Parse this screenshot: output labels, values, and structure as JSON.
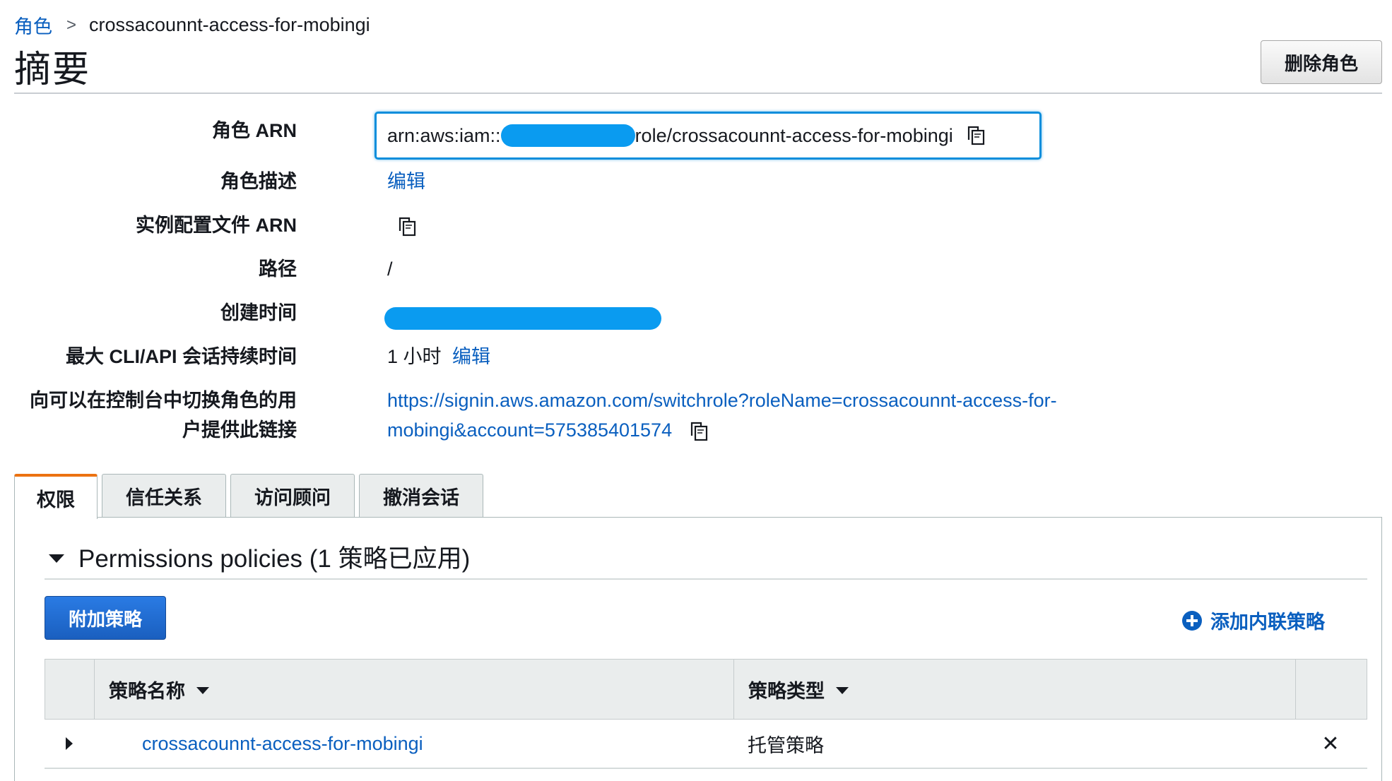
{
  "breadcrumb": {
    "parent": "角色",
    "separator": ">",
    "current": "crossacounnt-access-for-mobingi"
  },
  "page_title": "摘要",
  "delete_button": "删除角色",
  "summary": {
    "role_arn_label": "角色 ARN",
    "role_arn_prefix": "arn:aws:iam::",
    "role_arn_suffix": "role/crossacounnt-access-for-mobingi",
    "role_desc_label": "角色描述",
    "role_desc_edit": "编辑",
    "instance_profile_label": "实例配置文件 ARN",
    "path_label": "路径",
    "path_value": "/",
    "created_label": "创建时间",
    "max_session_label": "最大 CLI/API 会话持续时间",
    "max_session_value": "1 小时",
    "max_session_edit": "编辑",
    "switch_link_label_line1": "向可以在控制台中切换角色的用",
    "switch_link_label_line2": "户提供此链接",
    "switch_link_line1": "https://signin.aws.amazon.com/switchrole?roleName=crossacounnt-access-for-",
    "switch_link_line2": "mobingi&account=575385401574"
  },
  "tabs": [
    {
      "label": "权限",
      "active": true
    },
    {
      "label": "信任关系",
      "active": false
    },
    {
      "label": "访问顾问",
      "active": false
    },
    {
      "label": "撤消会话",
      "active": false
    }
  ],
  "permissions": {
    "section_title": "Permissions policies (1 策略已应用)",
    "attach_button": "附加策略",
    "add_inline": "添加内联策略",
    "columns": {
      "name": "策略名称",
      "type": "策略类型"
    },
    "rows": [
      {
        "name": "crossacounnt-access-for-mobingi",
        "type": "托管策略"
      }
    ]
  },
  "colors": {
    "link": "#0a5fbf",
    "redaction": "#0a9bf0",
    "active_tab_accent": "#ec7211",
    "primary_button": "#1a5fbf"
  }
}
